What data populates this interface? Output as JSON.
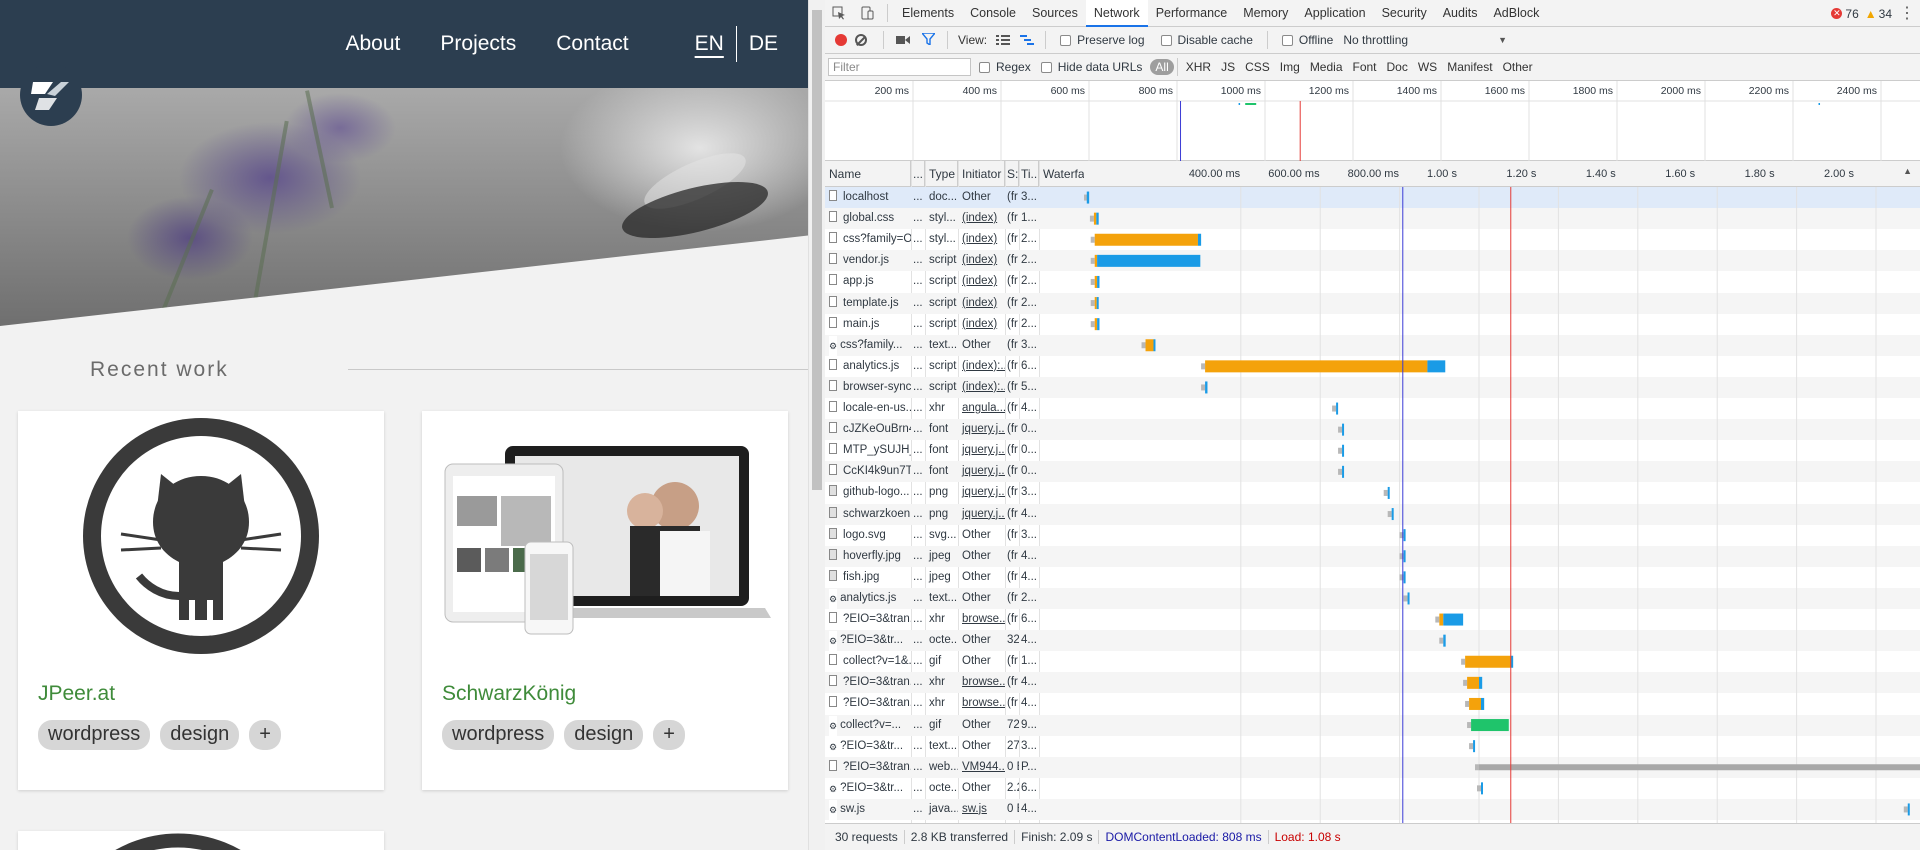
{
  "site": {
    "nav": [
      "About",
      "Projects",
      "Contact"
    ],
    "langs": [
      "EN",
      "DE"
    ],
    "recent_title": "Recent work",
    "cards": [
      {
        "title": "JPeer.at",
        "tags": [
          "wordpress",
          "design",
          "+"
        ]
      },
      {
        "title": "SchwarzKönig",
        "tags": [
          "wordpress",
          "design",
          "+"
        ]
      }
    ]
  },
  "devtools": {
    "tabs": [
      "Elements",
      "Console",
      "Sources",
      "Network",
      "Performance",
      "Memory",
      "Application",
      "Security",
      "Audits",
      "AdBlock"
    ],
    "active_tab": "Network",
    "error_count": "76",
    "warning_count": "34",
    "toolbar": {
      "view_label": "View:",
      "preserve_log": "Preserve log",
      "disable_cache": "Disable cache",
      "offline": "Offline",
      "throttling": "No throttling"
    },
    "filter": {
      "placeholder": "Filter",
      "regex": "Regex",
      "hide_data_urls": "Hide data URLs",
      "types": [
        "All",
        "XHR",
        "JS",
        "CSS",
        "Img",
        "Media",
        "Font",
        "Doc",
        "WS",
        "Manifest",
        "Other"
      ],
      "active_type": "All"
    },
    "overview_ticks": [
      "200 ms",
      "400 ms",
      "600 ms",
      "800 ms",
      "1000 ms",
      "1200 ms",
      "1400 ms",
      "1600 ms",
      "1800 ms",
      "2000 ms",
      "2200 ms",
      "2400 ms"
    ],
    "columns": [
      "Name",
      "...",
      "Type",
      "Initiator",
      "S:",
      "Ti...",
      "Waterfall"
    ],
    "waterfall_ticks": [
      "400.00 ms",
      "600.00 ms",
      "800.00 ms",
      "1.00 s",
      "1.20 s",
      "1.40 s",
      "1.60 s",
      "1.80 s",
      "2.00 s"
    ],
    "requests": [
      {
        "name": "localhost",
        "dots": "...",
        "type": "doc...",
        "initiator": "Other",
        "size": "(fr",
        "time": "3...",
        "icon": "doc",
        "start": 0.012,
        "wait": 0.0,
        "recv": 0.006,
        "color": "#1a9be6"
      },
      {
        "name": "global.css",
        "dots": "...",
        "type": "styl...",
        "initiator": "(index)",
        "size": "(fr",
        "time": "1...",
        "icon": "doc",
        "start": 0.03,
        "wait": 0.006,
        "recv": 0.006,
        "color": "#1a9be6"
      },
      {
        "name": "css?family=O...",
        "dots": "...",
        "type": "styl...",
        "initiator": "(index)",
        "size": "(fr",
        "time": "2...",
        "icon": "doc",
        "start": 0.032,
        "wait": 0.26,
        "recv": 0.008,
        "color": "#f4a20b"
      },
      {
        "name": "vendor.js",
        "dots": "...",
        "type": "script",
        "initiator": "(index)",
        "size": "(fr",
        "time": "2...",
        "icon": "doc",
        "start": 0.032,
        "wait": 0.006,
        "recv": 0.26,
        "color": "#1a9be6"
      },
      {
        "name": "app.js",
        "dots": "...",
        "type": "script",
        "initiator": "(index)",
        "size": "(fr",
        "time": "2...",
        "icon": "doc",
        "start": 0.032,
        "wait": 0.006,
        "recv": 0.006,
        "color": "#1a9be6"
      },
      {
        "name": "template.js",
        "dots": "...",
        "type": "script",
        "initiator": "(index)",
        "size": "(fr",
        "time": "2...",
        "icon": "doc",
        "start": 0.032,
        "wait": 0.005,
        "recv": 0.005,
        "color": "#1a9be6"
      },
      {
        "name": "main.js",
        "dots": "...",
        "type": "script",
        "initiator": "(index)",
        "size": "(fr",
        "time": "2...",
        "icon": "doc",
        "start": 0.032,
        "wait": 0.006,
        "recv": 0.006,
        "color": "#1a9be6"
      },
      {
        "name": "css?family...",
        "dots": "...",
        "type": "text...",
        "initiator": "Other",
        "size": "(fr",
        "time": "3...",
        "icon": "gear",
        "start": 0.16,
        "wait": 0.02,
        "recv": 0.004,
        "color": "#1a9be6"
      },
      {
        "name": "analytics.js",
        "dots": "...",
        "type": "script",
        "initiator": "(index):...",
        "size": "(fr",
        "time": "6...",
        "icon": "doc",
        "start": 0.31,
        "wait": 0.56,
        "recv": 0.045,
        "color": "#f4a20b"
      },
      {
        "name": "browser-sync...",
        "dots": "...",
        "type": "script",
        "initiator": "(index):...",
        "size": "(fr",
        "time": "5...",
        "icon": "doc",
        "start": 0.31,
        "wait": 0.0,
        "recv": 0.006,
        "color": "#1a9be6"
      },
      {
        "name": "locale-en-us...",
        "dots": "...",
        "type": "xhr",
        "initiator": "angula...",
        "size": "(fr",
        "time": "4...",
        "icon": "doc",
        "start": 0.64,
        "wait": 0.0,
        "recv": 0.005,
        "color": "#1a9be6"
      },
      {
        "name": "cJZKeOuBrn4...",
        "dots": "...",
        "type": "font",
        "initiator": "jquery.j...",
        "size": "(fr",
        "time": "0...",
        "icon": "doc",
        "start": 0.655,
        "wait": 0.0,
        "recv": 0.005,
        "color": "#1a9be6"
      },
      {
        "name": "MTP_ySUJH_...",
        "dots": "...",
        "type": "font",
        "initiator": "jquery.j...",
        "size": "(fr",
        "time": "0...",
        "icon": "doc",
        "start": 0.655,
        "wait": 0.0,
        "recv": 0.005,
        "color": "#1a9be6"
      },
      {
        "name": "CcKI4k9un7T...",
        "dots": "...",
        "type": "font",
        "initiator": "jquery.j...",
        "size": "(fr",
        "time": "0...",
        "icon": "doc",
        "start": 0.655,
        "wait": 0.0,
        "recv": 0.005,
        "color": "#1a9be6"
      },
      {
        "name": "github-logo...",
        "dots": "...",
        "type": "png",
        "initiator": "jquery.j...",
        "size": "(fr",
        "time": "3...",
        "icon": "img",
        "start": 0.77,
        "wait": 0.0,
        "recv": 0.005,
        "color": "#1a9be6"
      },
      {
        "name": "schwarzkoen...",
        "dots": "...",
        "type": "png",
        "initiator": "jquery.j...",
        "size": "(fr",
        "time": "4...",
        "icon": "img",
        "start": 0.78,
        "wait": 0.0,
        "recv": 0.005,
        "color": "#1a9be6"
      },
      {
        "name": "logo.svg",
        "dots": "...",
        "type": "svg...",
        "initiator": "Other",
        "size": "(fr",
        "time": "3...",
        "icon": "img",
        "start": 0.81,
        "wait": 0.0,
        "recv": 0.005,
        "color": "#1a9be6"
      },
      {
        "name": "hoverfly.jpg",
        "dots": "...",
        "type": "jpeg",
        "initiator": "Other",
        "size": "(fr",
        "time": "4...",
        "icon": "img",
        "start": 0.81,
        "wait": 0.0,
        "recv": 0.005,
        "color": "#1a9be6"
      },
      {
        "name": "fish.jpg",
        "dots": "...",
        "type": "jpeg",
        "initiator": "Other",
        "size": "(fr",
        "time": "4...",
        "icon": "img",
        "start": 0.81,
        "wait": 0.0,
        "recv": 0.005,
        "color": "#1a9be6"
      },
      {
        "name": "analytics.js",
        "dots": "...",
        "type": "text...",
        "initiator": "Other",
        "size": "(fr",
        "time": "2...",
        "icon": "gear",
        "start": 0.82,
        "wait": 0.0,
        "recv": 0.005,
        "color": "#1a9be6"
      },
      {
        "name": "?EIO=3&tran...",
        "dots": "...",
        "type": "xhr",
        "initiator": "browse...",
        "size": "(fr",
        "time": "6...",
        "icon": "doc",
        "start": 0.9,
        "wait": 0.01,
        "recv": 0.05,
        "color": "#1a9be6"
      },
      {
        "name": "?EIO=3&tr...",
        "dots": "...",
        "type": "octe...",
        "initiator": "Other",
        "size": "32",
        "time": "4...",
        "icon": "gear",
        "start": 0.91,
        "wait": 0.0,
        "recv": 0.006,
        "color": "#1a9be6"
      },
      {
        "name": "collect?v=1&...",
        "dots": "...",
        "type": "gif",
        "initiator": "Other",
        "size": "(fr",
        "time": "1...",
        "icon": "doc",
        "start": 0.965,
        "wait": 0.115,
        "recv": 0.006,
        "color": "#f4a20b"
      },
      {
        "name": "?EIO=3&tran...",
        "dots": "...",
        "type": "xhr",
        "initiator": "browse...",
        "size": "(fr",
        "time": "4...",
        "icon": "doc",
        "start": 0.97,
        "wait": 0.03,
        "recv": 0.008,
        "color": "#1a9be6"
      },
      {
        "name": "?EIO=3&tran...",
        "dots": "...",
        "type": "xhr",
        "initiator": "browse...",
        "size": "(fr",
        "time": "4...",
        "icon": "doc",
        "start": 0.975,
        "wait": 0.03,
        "recv": 0.008,
        "color": "#1a9be6"
      },
      {
        "name": "collect?v=...",
        "dots": "...",
        "type": "gif",
        "initiator": "Other",
        "size": "72",
        "time": "9...",
        "icon": "gear",
        "start": 0.98,
        "wait": 0.0,
        "recv": 0.095,
        "color": "#1fc46b"
      },
      {
        "name": "?EIO=3&tr...",
        "dots": "...",
        "type": "text...",
        "initiator": "Other",
        "size": "27",
        "time": "3...",
        "icon": "gear",
        "start": 0.985,
        "wait": 0.0,
        "recv": 0.005,
        "color": "#1a9be6"
      },
      {
        "name": "?EIO=3&tran...",
        "dots": "...",
        "type": "web...",
        "initiator": "VM944...",
        "size": "0 E",
        "time": "P...",
        "icon": "doc",
        "start": 1.0,
        "wait": 0.0,
        "recv": 1.3,
        "color": "#a8a8a8"
      },
      {
        "name": "?EIO=3&tr...",
        "dots": "...",
        "type": "octe...",
        "initiator": "Other",
        "size": "2.2",
        "time": "6...",
        "icon": "gear",
        "start": 1.005,
        "wait": 0.0,
        "recv": 0.005,
        "color": "#1a9be6"
      },
      {
        "name": "sw.js",
        "dots": "...",
        "type": "java...",
        "initiator": "sw.js",
        "size": "0 E",
        "time": "4...",
        "icon": "gear",
        "start": 2.08,
        "wait": 0.0,
        "recv": 0.005,
        "color": "#1a9be6"
      }
    ],
    "status": {
      "requests": "30 requests",
      "transferred": "2.8 KB transferred",
      "finish": "Finish: 2.09 s",
      "dom_content_loaded": "DOMContentLoaded: 808 ms",
      "load": "Load: 1.08 s"
    },
    "colors": {
      "accent": "#1a73e8",
      "waiting": "#f4a20b",
      "receiving": "#1a9be6",
      "dcl_line": "#3b3bd6",
      "load_line": "#e53935"
    }
  }
}
